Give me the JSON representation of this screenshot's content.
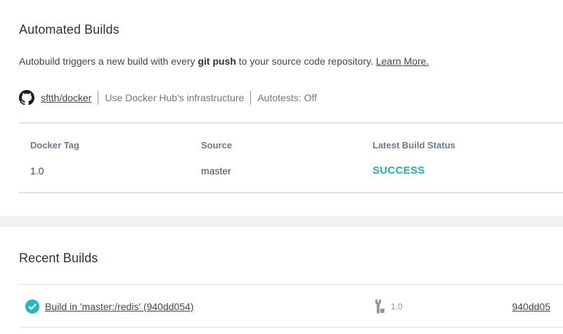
{
  "automated_builds": {
    "title": "Automated Builds",
    "description": {
      "prefix": "Autobuild triggers a new build with every ",
      "bold": "git push",
      "suffix": " to your source code repository. ",
      "link": "Learn More."
    },
    "source": {
      "icon": "github-icon",
      "repo": "sftth/docker",
      "infrastructure": "Use Docker Hub's infrastructure",
      "autotests": "Autotests: Off"
    },
    "table": {
      "headers": [
        "Docker Tag",
        "Source",
        "Latest Build Status"
      ],
      "rows": [
        {
          "tag": "1.0",
          "source": "master",
          "status": "SUCCESS"
        }
      ]
    },
    "status_color": "#1fb5b5"
  },
  "recent_builds": {
    "title": "Recent Builds",
    "items": [
      {
        "status_icon": "check-circle-icon",
        "label": "Build in 'master:/redis' (940dd054)",
        "tag_icon": "wrench-icon",
        "tag": "1.0",
        "commit": "940dd05"
      }
    ],
    "success_color": "#20b9bd"
  }
}
